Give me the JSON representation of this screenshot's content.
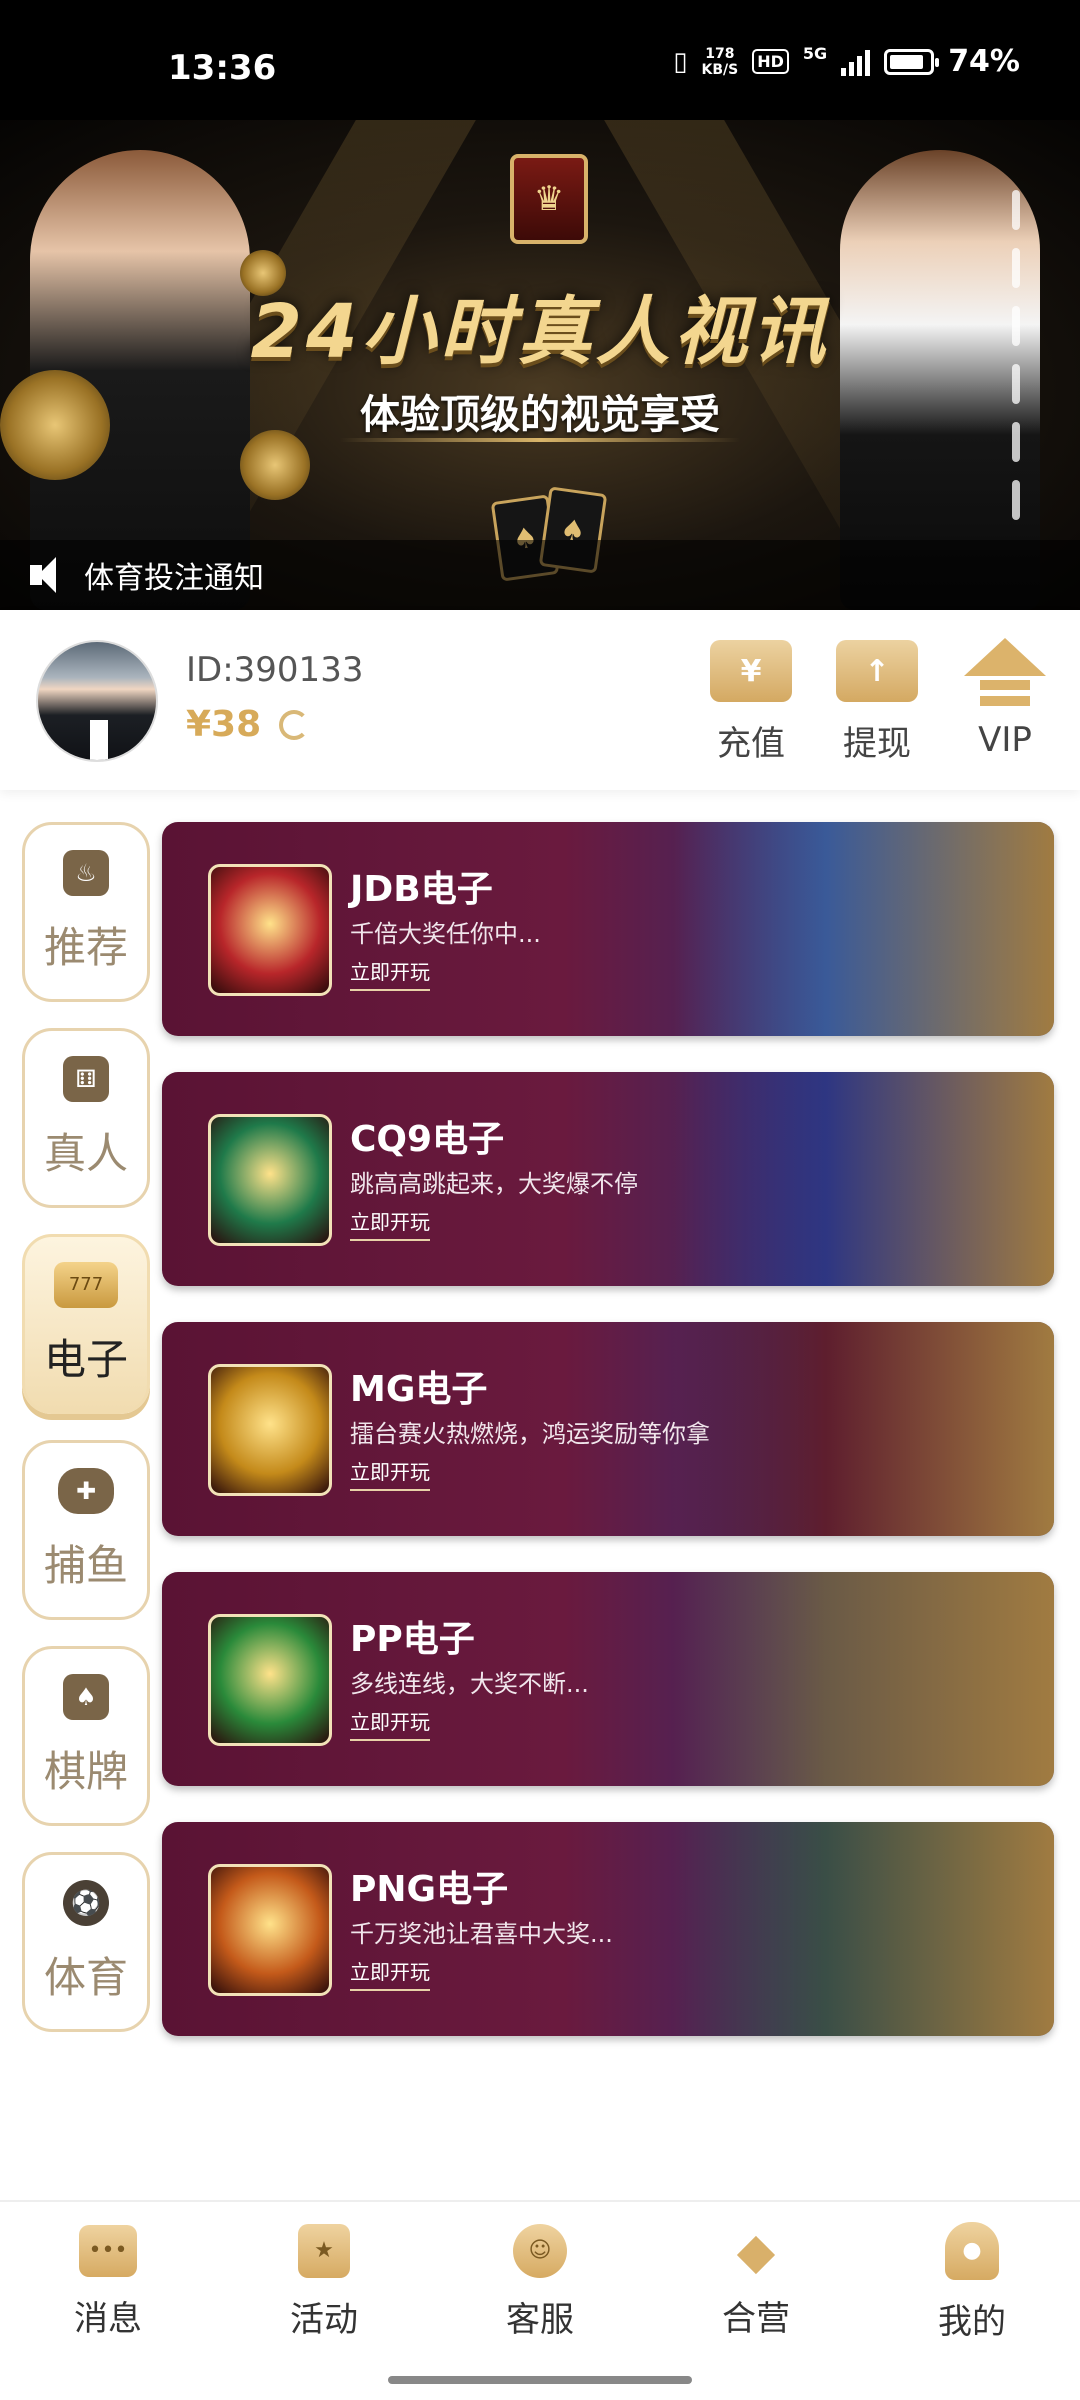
{
  "status_bar": {
    "time": "13:36",
    "net_speed_value": "178",
    "net_speed_unit": "KB/S",
    "hd": "HD",
    "network": "5G",
    "battery_percent_label": "74%",
    "battery_level": 0.74
  },
  "banner": {
    "title": "24小时真人视讯",
    "subtitle": "体验顶级的视觉享受",
    "notice": "体育投注通知",
    "slide_count": 6
  },
  "user": {
    "id_label": "ID:390133",
    "balance": "¥38"
  },
  "actions": [
    {
      "label": "充值",
      "icon": "deposit-icon",
      "glyph": "¥"
    },
    {
      "label": "提现",
      "icon": "withdraw-icon",
      "glyph": "↑"
    },
    {
      "label": "VIP",
      "icon": "vip-icon",
      "glyph": ""
    }
  ],
  "categories": [
    {
      "label": "推荐",
      "icon": "flame-icon",
      "glyph": "♨",
      "active": false
    },
    {
      "label": "真人",
      "icon": "dice-icon",
      "glyph": "⚅",
      "active": false
    },
    {
      "label": "电子",
      "icon": "slot-machine-icon",
      "glyph": "777",
      "active": true
    },
    {
      "label": "捕鱼",
      "icon": "gamepad-icon",
      "glyph": "✚",
      "active": false
    },
    {
      "label": "棋牌",
      "icon": "spade-card-icon",
      "glyph": "♠",
      "active": false
    },
    {
      "label": "体育",
      "icon": "soccer-ball-icon",
      "glyph": "⚽",
      "active": false
    }
  ],
  "games": [
    {
      "name": "JDB电子",
      "desc": "千倍大奖任你中...",
      "play": "立即开玩",
      "thumb_color": "#b8262a",
      "art_color": "#3a6aa8"
    },
    {
      "name": "CQ9电子",
      "desc": "跳高高跳起来，大奖爆不停",
      "play": "立即开玩",
      "thumb_color": "#1f7a4a",
      "art_color": "#2a3a8a"
    },
    {
      "name": "MG电子",
      "desc": "擂台赛火热燃烧，鸿运奖励等你拿",
      "play": "立即开玩",
      "thumb_color": "#c48a1a",
      "art_color": "#6a1a1a"
    },
    {
      "name": "PP电子",
      "desc": "多线连线，大奖不断...",
      "play": "立即开玩",
      "thumb_color": "#2a8a3a",
      "art_color": "#7a6a3a"
    },
    {
      "name": "PNG电子",
      "desc": "千万奖池让君喜中大奖...",
      "play": "立即开玩",
      "thumb_color": "#c45a1a",
      "art_color": "#3a5a3a"
    }
  ],
  "bottom_nav": [
    {
      "label": "消息",
      "icon": "message-icon",
      "glyph": "•••"
    },
    {
      "label": "活动",
      "icon": "gift-icon",
      "glyph": "★"
    },
    {
      "label": "客服",
      "icon": "customer-service-icon",
      "glyph": "☺"
    },
    {
      "label": "合营",
      "icon": "diamond-icon",
      "glyph": "◆"
    },
    {
      "label": "我的",
      "icon": "profile-icon",
      "glyph": "●"
    }
  ]
}
